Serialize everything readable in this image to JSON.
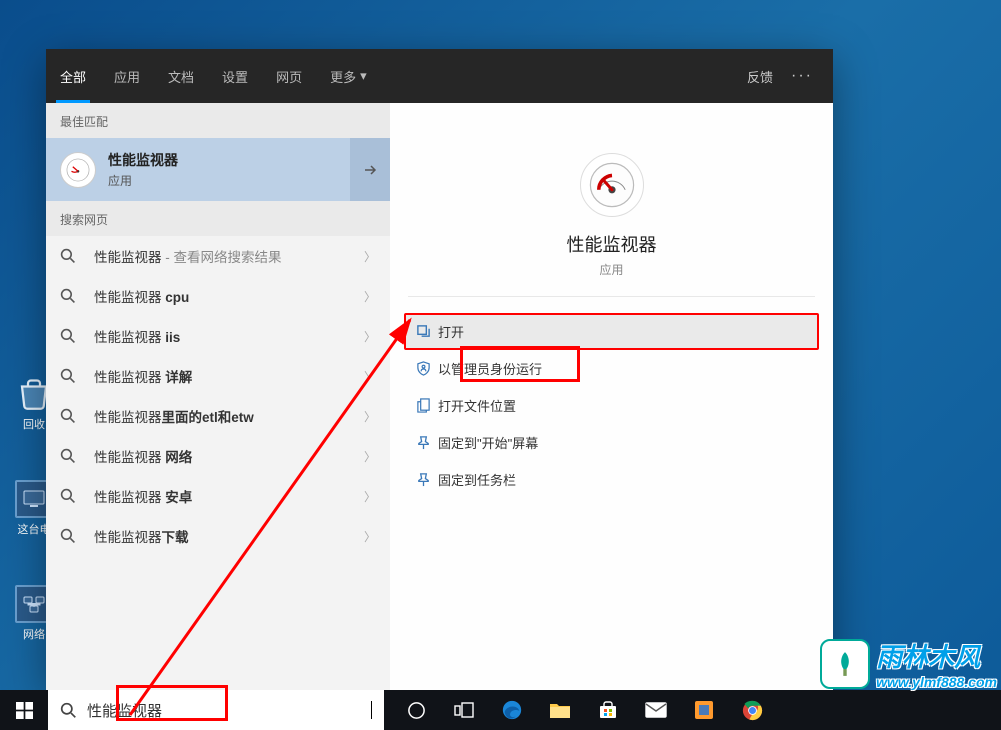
{
  "desktop": {
    "recycle": "回收",
    "this_pc": "这台电",
    "network": "网络"
  },
  "header": {
    "tabs": [
      "全部",
      "应用",
      "文档",
      "设置",
      "网页",
      "更多"
    ],
    "feedback": "反馈"
  },
  "left": {
    "best_label": "最佳匹配",
    "best": {
      "title": "性能监视器",
      "sub": "应用"
    },
    "web_label": "搜索网页",
    "items": [
      {
        "text": "性能监视器",
        "suffix": " - 查看网络搜索结果"
      },
      {
        "text": "性能监视器 ",
        "bold": "cpu"
      },
      {
        "text": "性能监视器 ",
        "bold": "iis"
      },
      {
        "text": "性能监视器 ",
        "bold": "详解"
      },
      {
        "text": "性能监视器",
        "bold": "里面的etl和etw"
      },
      {
        "text": "性能监视器 ",
        "bold": "网络"
      },
      {
        "text": "性能监视器 ",
        "bold": "安卓"
      },
      {
        "text": "性能监视器",
        "bold": "下载"
      }
    ]
  },
  "right": {
    "title": "性能监视器",
    "sub": "应用",
    "actions": [
      {
        "label": "打开",
        "icon": "open"
      },
      {
        "label": "以管理员身份运行",
        "icon": "admin"
      },
      {
        "label": "打开文件位置",
        "icon": "folder"
      },
      {
        "label": "固定到\"开始\"屏幕",
        "icon": "pin-start"
      },
      {
        "label": "固定到任务栏",
        "icon": "pin-taskbar"
      }
    ]
  },
  "taskbar": {
    "search_value": "性能监视器"
  },
  "watermark": {
    "cn": "雨林木风",
    "url": "www.ylmf888.com"
  }
}
